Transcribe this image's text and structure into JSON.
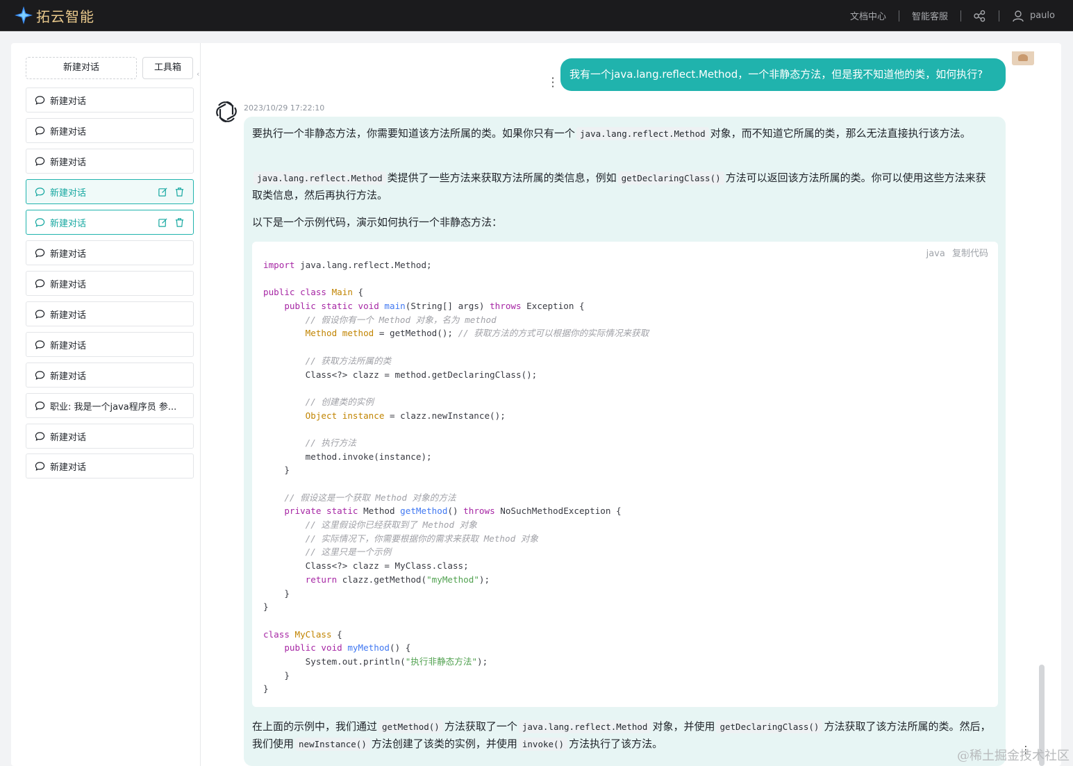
{
  "header": {
    "brand": "拓云智能",
    "nav": [
      "文档中心",
      "智能客服"
    ],
    "username": "paulo",
    "accent_color": "#e9c98c"
  },
  "sidebar": {
    "new_chat_label": "新建对话",
    "toolbox_label": "工具箱",
    "conversations": [
      {
        "label": "新建对话"
      },
      {
        "label": "新建对话"
      },
      {
        "label": "新建对话"
      },
      {
        "label": "新建对话",
        "state": "active-selected"
      },
      {
        "label": "新建对话",
        "state": "active"
      },
      {
        "label": "新建对话"
      },
      {
        "label": "新建对话"
      },
      {
        "label": "新建对话"
      },
      {
        "label": "新建对话"
      },
      {
        "label": "新建对话"
      },
      {
        "label": "职业: 我是一个java程序员 参..."
      },
      {
        "label": "新建对话"
      },
      {
        "label": "新建对话"
      }
    ]
  },
  "chat": {
    "user_message": "我有一个java.lang.reflect.Method，一个非静态方法，但是我不知道他的类，如何执行?",
    "timestamp": "2023/10/29 17:22:10",
    "p1": {
      "a": "要执行一个非静态方法，你需要知道该方法所属的类。如果你只有一个",
      "code": "java.lang.reflect.Method",
      "b": "对象，而不知道它所属的类，那么无法直接执行该方法。"
    },
    "p2": {
      "code1": "java.lang.reflect.Method",
      "a": "类提供了一些方法来获取方法所属的类信息，例如",
      "code2": "getDeclaringClass()",
      "b": "方法可以返回该方法所属的类。你可以使用这些方法来获取类信息，然后再执行方法。"
    },
    "p3": "以下是一个示例代码，演示如何执行一个非静态方法：",
    "code_lang": "java",
    "copy_label": "复制代码",
    "p4": {
      "a": "在上面的示例中，我们通过",
      "code1": "getMethod()",
      "b": "方法获取了一个",
      "code2": "java.lang.reflect.Method",
      "c": "对象，并使用",
      "code3": "getDeclaringClass()",
      "d": "方法获取了该方法所属的类。然后，我们使用",
      "code4": "newInstance()",
      "e": "方法创建了该类的实例，并使用",
      "code5": "invoke()",
      "f": "方法执行了该方法。"
    }
  },
  "code_lines": [
    [
      [
        "kw",
        "import"
      ],
      [
        "",
        " java.lang.reflect.Method;"
      ]
    ],
    [],
    [
      [
        "kw",
        "public class "
      ],
      [
        "cls",
        "Main"
      ],
      [
        "",
        " {"
      ]
    ],
    [
      [
        "",
        "    "
      ],
      [
        "kw",
        "public static void "
      ],
      [
        "fn",
        "main"
      ],
      [
        "",
        "(String[] args) "
      ],
      [
        "kw",
        "throws"
      ],
      [
        "",
        " Exception {"
      ]
    ],
    [
      [
        "",
        "        "
      ],
      [
        "cmt",
        "// 假设你有一个 Method 对象，名为 method"
      ]
    ],
    [
      [
        "",
        "        "
      ],
      [
        "cls",
        "Method method"
      ],
      [
        "",
        " = getMethod(); "
      ],
      [
        "cmt",
        "// 获取方法的方式可以根据你的实际情况来获取"
      ]
    ],
    [],
    [
      [
        "",
        "        "
      ],
      [
        "cmt",
        "// 获取方法所属的类"
      ]
    ],
    [
      [
        "",
        "        Class<?> clazz = method.getDeclaringClass();"
      ]
    ],
    [],
    [
      [
        "",
        "        "
      ],
      [
        "cmt",
        "// 创建类的实例"
      ]
    ],
    [
      [
        "",
        "        "
      ],
      [
        "cls",
        "Object instance"
      ],
      [
        "",
        " = clazz.newInstance();"
      ]
    ],
    [],
    [
      [
        "",
        "        "
      ],
      [
        "cmt",
        "// 执行方法"
      ]
    ],
    [
      [
        "",
        "        method.invoke(instance);"
      ]
    ],
    [
      [
        "",
        "    }"
      ]
    ],
    [],
    [
      [
        "",
        "    "
      ],
      [
        "cmt",
        "// 假设这是一个获取 Method 对象的方法"
      ]
    ],
    [
      [
        "",
        "    "
      ],
      [
        "kw",
        "private static "
      ],
      [
        "",
        "Method "
      ],
      [
        "fn",
        "getMethod"
      ],
      [
        "",
        "() "
      ],
      [
        "kw",
        "throws"
      ],
      [
        "",
        " NoSuchMethodException {"
      ]
    ],
    [
      [
        "",
        "        "
      ],
      [
        "cmt",
        "// 这里假设你已经获取到了 Method 对象"
      ]
    ],
    [
      [
        "",
        "        "
      ],
      [
        "cmt",
        "// 实际情况下，你需要根据你的需求来获取 Method 对象"
      ]
    ],
    [
      [
        "",
        "        "
      ],
      [
        "cmt",
        "// 这里只是一个示例"
      ]
    ],
    [
      [
        "",
        "        Class<?> clazz = MyClass.class;"
      ]
    ],
    [
      [
        "",
        "        "
      ],
      [
        "kw",
        "return"
      ],
      [
        "",
        " clazz.getMethod("
      ],
      [
        "str",
        "\"myMethod\""
      ],
      [
        "",
        ");"
      ]
    ],
    [
      [
        "",
        "    }"
      ]
    ],
    [
      [
        "",
        "}"
      ]
    ],
    [],
    [
      [
        "kw",
        "class "
      ],
      [
        "cls",
        "MyClass"
      ],
      [
        "",
        " {"
      ]
    ],
    [
      [
        "",
        "    "
      ],
      [
        "kw",
        "public void "
      ],
      [
        "fn",
        "myMethod"
      ],
      [
        "",
        "() {"
      ]
    ],
    [
      [
        "",
        "        System.out.println("
      ],
      [
        "str",
        "\"执行非静态方法\""
      ],
      [
        "",
        ");"
      ]
    ],
    [
      [
        "",
        "    }"
      ]
    ],
    [
      [
        "",
        "}"
      ]
    ]
  ],
  "watermark": "@稀土掘金技术社区"
}
